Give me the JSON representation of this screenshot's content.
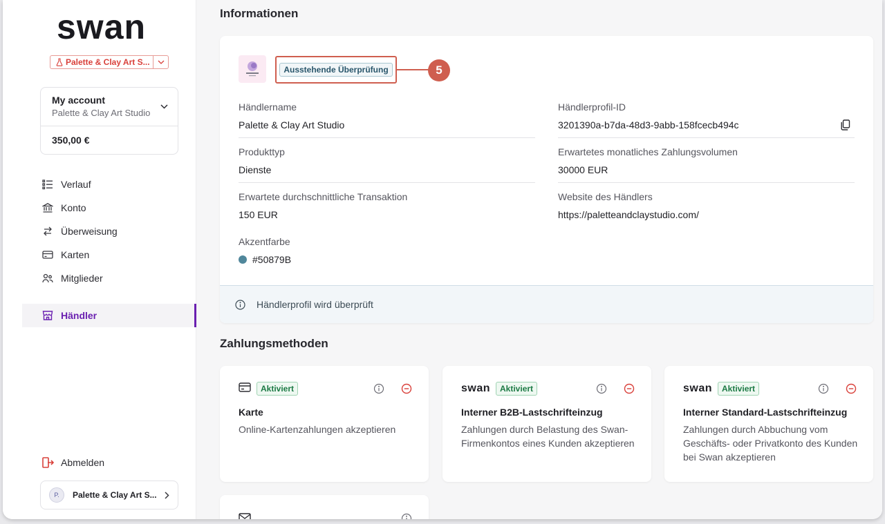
{
  "brand": {
    "logo_text": "swan"
  },
  "sidebar": {
    "project": {
      "name": "Palette & Clay Art S...",
      "color": "#d9403a"
    },
    "account": {
      "title": "My account",
      "subtitle": "Palette & Clay Art Studio",
      "balance": "350,00 €"
    },
    "nav": [
      {
        "label": "Verlauf",
        "icon": "list-icon"
      },
      {
        "label": "Konto",
        "icon": "bank-icon"
      },
      {
        "label": "Überweisung",
        "icon": "transfer-icon"
      },
      {
        "label": "Karten",
        "icon": "card-icon"
      },
      {
        "label": "Mitglieder",
        "icon": "members-icon"
      }
    ],
    "active_item": {
      "label": "Händler",
      "icon": "store-icon",
      "color": "#6a1fb0"
    },
    "logout_label": "Abmelden",
    "user": {
      "initial": "P.",
      "name": "Palette & Clay Art S..."
    }
  },
  "main": {
    "info_title": "Informationen",
    "status_badge": "Ausstehende Überprüfung",
    "callout_number": "5",
    "fields": {
      "merchant_name": {
        "label": "Händlername",
        "value": "Palette & Clay Art Studio"
      },
      "profile_id": {
        "label": "Händlerprofil-ID",
        "value": "3201390a-b7da-48d3-9abb-158fcecb494c"
      },
      "product_type": {
        "label": "Produkttyp",
        "value": "Dienste"
      },
      "expected_volume": {
        "label": "Erwartetes monatliches Zahlungsvolumen",
        "value": "30000 EUR"
      },
      "avg_transaction": {
        "label": "Erwartete durchschnittliche Transaktion",
        "value": "150 EUR"
      },
      "website": {
        "label": "Website des Händlers",
        "value": "https://paletteandclaystudio.com/"
      },
      "accent_color": {
        "label": "Akzentfarbe",
        "value": "#50879B"
      }
    },
    "info_banner": "Händlerprofil wird überprüft",
    "payment_title": "Zahlungsmethoden",
    "payment_methods": [
      {
        "badge": "Aktiviert",
        "title": "Karte",
        "description": "Online-Kartenzahlungen akzeptieren"
      },
      {
        "logo": "swan",
        "badge": "Aktiviert",
        "title": "Interner B2B-Lastschrifteinzug",
        "description": "Zahlungen durch Belastung des Swan-Firmenkontos eines Kunden akzeptieren"
      },
      {
        "logo": "swan",
        "badge": "Aktiviert",
        "title": "Interner Standard-Lastschrifteinzug",
        "description": "Zahlungen durch Abbuchung vom Geschäfts- oder Privatkonto des Kunden bei Swan akzeptieren"
      }
    ]
  }
}
